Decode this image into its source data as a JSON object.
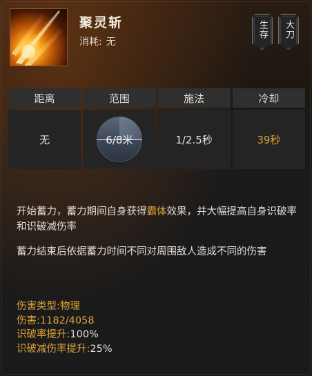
{
  "skill": {
    "name": "聚灵斩",
    "cost_label": "消耗:",
    "cost_value": "无",
    "icon": "slash-burst-icon"
  },
  "badges": [
    {
      "text": "生存"
    },
    {
      "text": "大刀"
    }
  ],
  "stats": {
    "headers": [
      "距离",
      "范围",
      "施法",
      "冷却"
    ],
    "values": [
      "无",
      "6/8米",
      "1/2.5秒",
      "39秒"
    ],
    "accent_color": "#e0a23a"
  },
  "description": {
    "p1_a": "开始蓄力，蓄力期间自身获得",
    "p1_hl": "霸体",
    "p1_b": "效果，并大幅提高自身识破率和识破减伤率",
    "p2": "蓄力结束后依据蓄力时间不同对周围敌人造成不同的伤害"
  },
  "properties": {
    "damage_type_label": "伤害类型:",
    "damage_type_value": "物理",
    "damage_label": "伤害:",
    "damage_value": "1182/4058",
    "crit_label": "识破率提升:",
    "crit_value": "100%",
    "crit_reduce_label": "识破减伤率提升:",
    "crit_reduce_value": "25%"
  }
}
